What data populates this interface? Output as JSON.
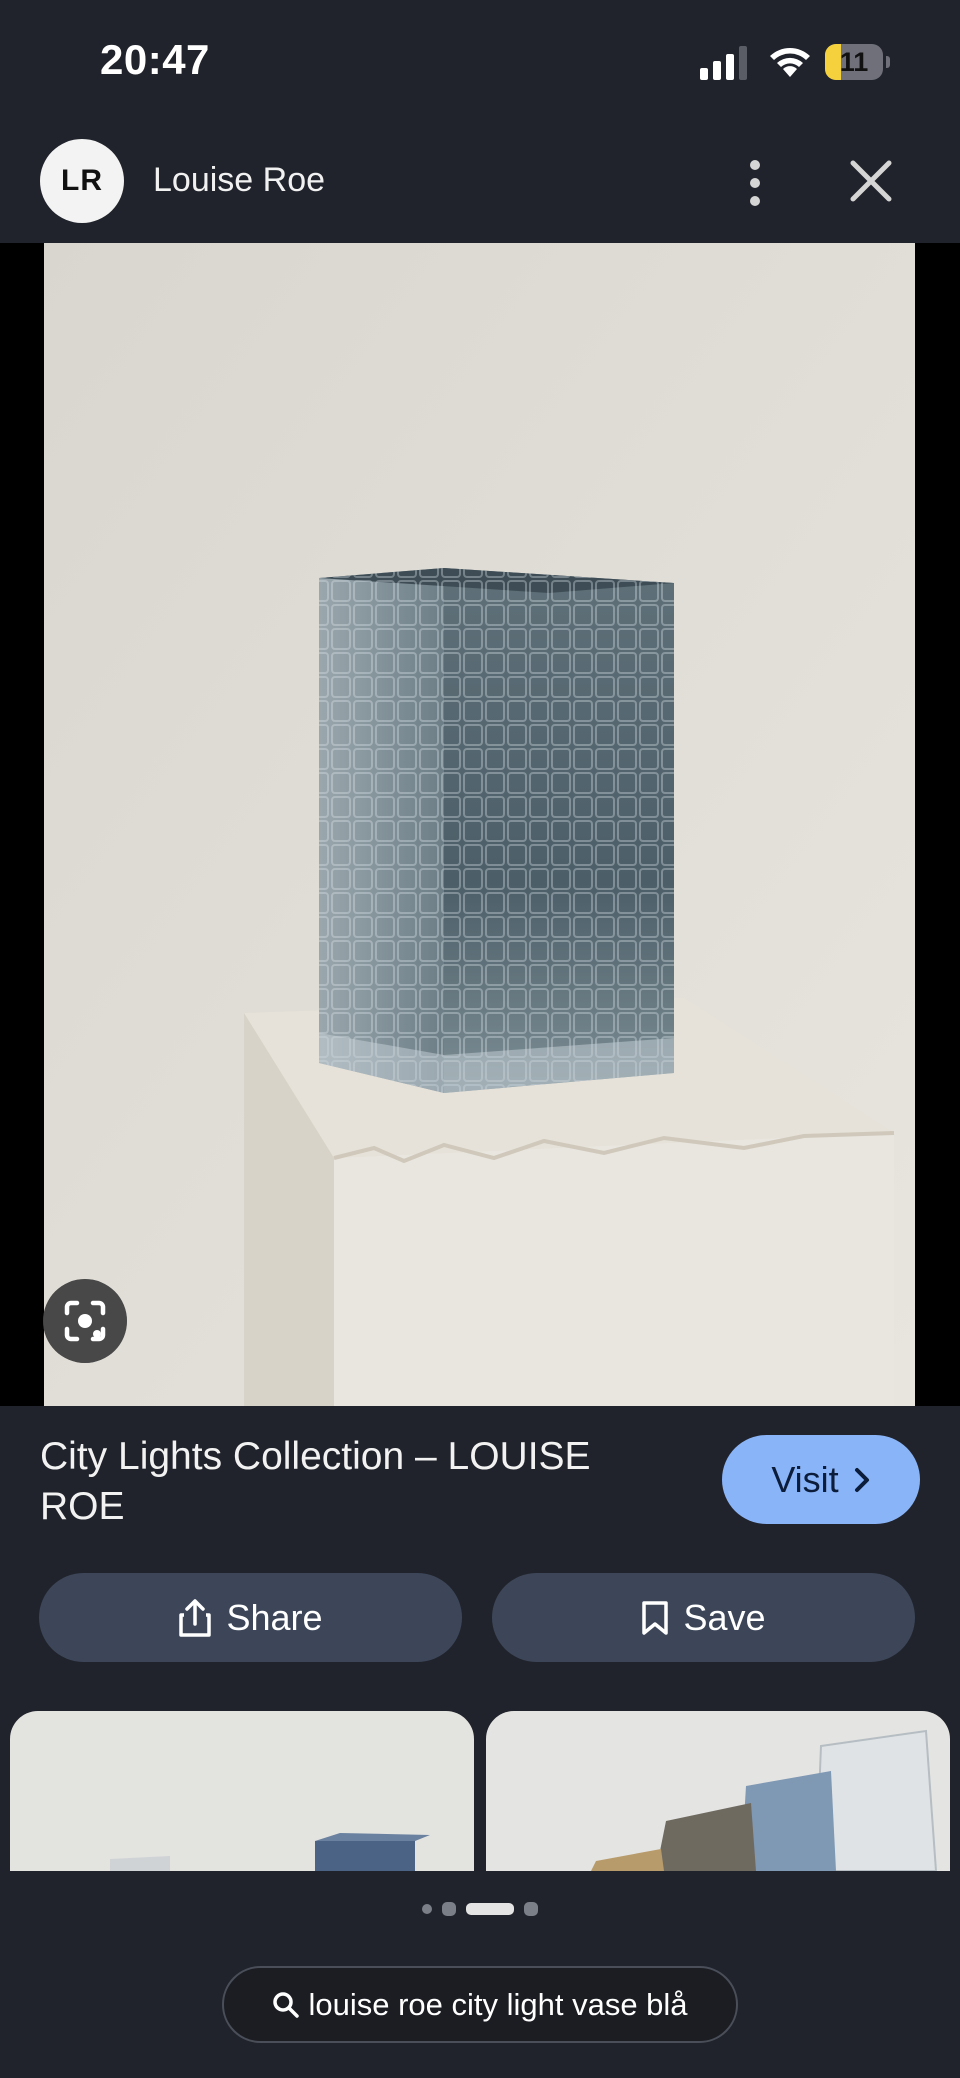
{
  "status_bar": {
    "time": "20:47",
    "battery_level": "11",
    "battery_fraction": 0.11
  },
  "header": {
    "avatar_initials": "LR",
    "source_name": "Louise Roe"
  },
  "result": {
    "title": "City Lights Collection – LOUISE ROE",
    "visit_label": "Visit",
    "share_label": "Share",
    "save_label": "Save"
  },
  "pager": {
    "count": 4,
    "active_index": 2
  },
  "search": {
    "query": "louise roe city light vase blå"
  },
  "icons": [
    "signal-icon",
    "wifi-icon",
    "battery-icon",
    "more-vert-icon",
    "close-icon",
    "lens-icon",
    "chevron-right-icon",
    "share-icon",
    "bookmark-icon",
    "search-icon"
  ],
  "colors": {
    "background": "#20232b",
    "visit_button": "#8ab4f8",
    "secondary_button": "#3c4658"
  }
}
